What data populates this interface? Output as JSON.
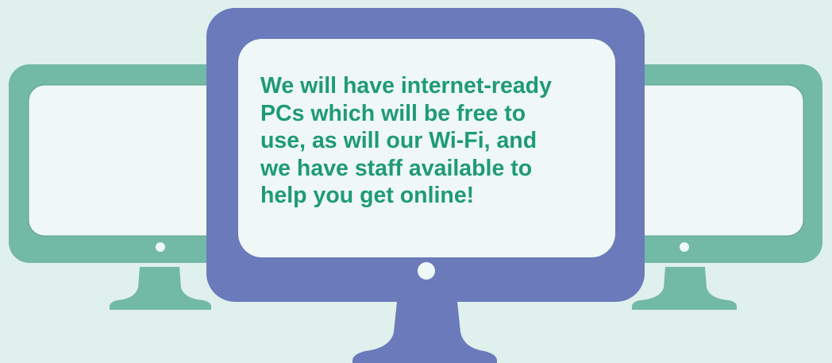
{
  "message": {
    "text": "We will have internet-ready\nPCs which will be free to\nuse, as will our Wi-Fi, and\nwe have staff available to\nhelp you get online!"
  },
  "colors": {
    "background": "#dff0ed",
    "side_monitor": "#72b9a6",
    "center_monitor": "#6b7abb",
    "screen": "#eff8f6",
    "text": "#1f9a78"
  },
  "icons": {
    "left_monitor": "desktop-monitor-icon",
    "center_monitor": "desktop-monitor-icon",
    "right_monitor": "desktop-monitor-icon"
  }
}
